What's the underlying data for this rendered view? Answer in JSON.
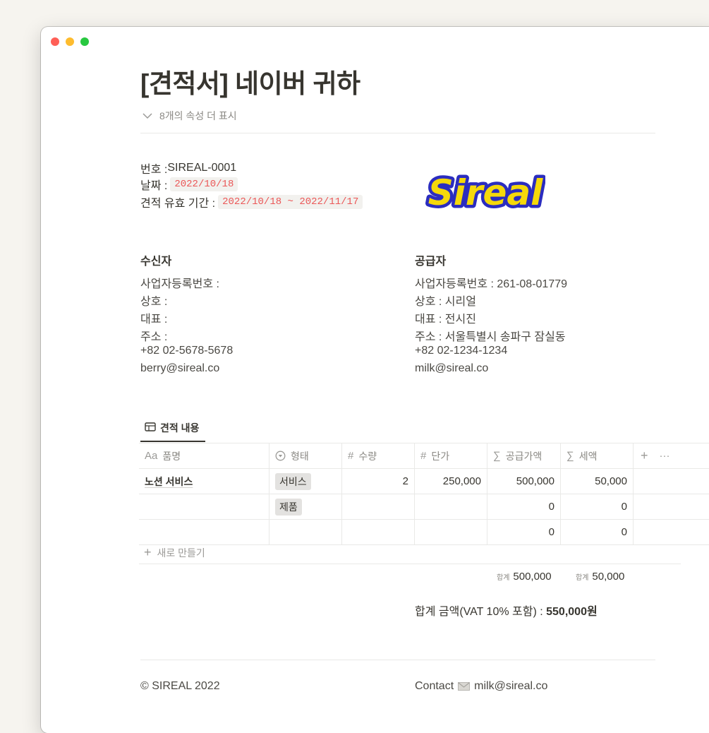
{
  "window": {
    "traffic_colors": {
      "close": "#ff5f57",
      "minimize": "#febc2e",
      "maximize": "#28c840"
    }
  },
  "page": {
    "title": "[견적서] 네이버 귀하",
    "props_toggle": "8개의 속성 더 표시"
  },
  "meta": {
    "number_label": "번호 : ",
    "number_value": "SIREAL-0001",
    "date_label": "날짜 : ",
    "date_value": "2022/10/18",
    "validity_label": "견적 유효 기간 : ",
    "validity_value": "2022/10/18 ~ 2022/11/17"
  },
  "logo": {
    "text": "Sireal",
    "fill": "#f5d90a",
    "outline": "#2b2dbf"
  },
  "recipient": {
    "heading": "수신자",
    "lines": [
      "사업자등록번호 :",
      "상호 :",
      "대표 :",
      "주소 :",
      "+82 02-5678-5678",
      "berry@sireal.co"
    ]
  },
  "supplier": {
    "heading": "공급자",
    "lines": [
      "사업자등록번호 : 261-08-01779",
      "상호 : 시리얼",
      "대표 : 전시진",
      "주소 : 서울특별시 송파구 잠실동",
      "+82 02-1234-1234",
      "milk@sireal.co"
    ]
  },
  "database": {
    "tab_label": "견적 내용",
    "headers": {
      "name": "품명",
      "name_icon": "Aa",
      "type": "형태",
      "qty": "수량",
      "qty_icon": "#",
      "unit": "단가",
      "unit_icon": "#",
      "supply": "공급가액",
      "supply_icon": "∑",
      "tax": "세액",
      "tax_icon": "∑",
      "add": "+",
      "more": "···"
    },
    "rows": [
      {
        "name": "노션 서비스",
        "type": "서비스",
        "qty": "2",
        "unit": "250,000",
        "supply": "500,000",
        "tax": "50,000"
      },
      {
        "name": "",
        "type": "제품",
        "qty": "",
        "unit": "",
        "supply": "0",
        "tax": "0"
      },
      {
        "name": "",
        "type": "",
        "qty": "",
        "unit": "",
        "supply": "0",
        "tax": "0"
      }
    ],
    "new_row": "새로 만들기",
    "sum_label": "합계",
    "supply_sum": "500,000",
    "tax_sum": "50,000"
  },
  "total": {
    "label": "합계 금액(VAT 10% 포함) : ",
    "value": "550,000원"
  },
  "footer": {
    "copyright": "© SIREAL 2022",
    "contact_label": "Contact",
    "contact_email": "milk@sireal.co"
  }
}
